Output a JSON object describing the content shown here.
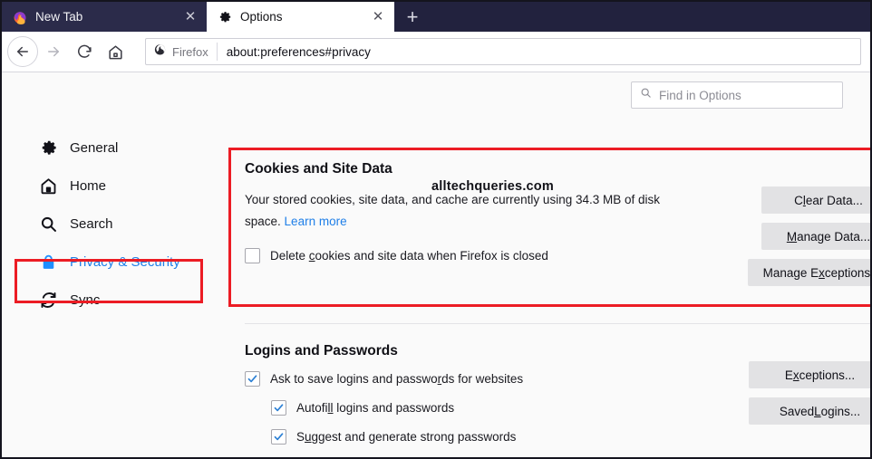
{
  "browser": {
    "tabs": [
      {
        "title": "New Tab",
        "favicon": "firefox-logo-icon",
        "active": false,
        "close_glyph": "✕"
      },
      {
        "title": "Options",
        "favicon": "gear-icon",
        "active": true,
        "close_glyph": "✕"
      }
    ],
    "new_tab_glyph": "+",
    "nav": {
      "back_label": "←",
      "forward_label": "→",
      "reload_label": "⟳",
      "home_label": "⌂"
    },
    "urlbar": {
      "identity_label": "Firefox",
      "identity_icon": "firefox-logo-icon",
      "url": "about:preferences#privacy"
    }
  },
  "sidebar": {
    "items": [
      {
        "label": "General",
        "icon": "gear-icon"
      },
      {
        "label": "Home",
        "icon": "home-icon"
      },
      {
        "label": "Search",
        "icon": "search-icon"
      },
      {
        "label": "Privacy & Security",
        "icon": "lock-icon"
      },
      {
        "label": "Sync",
        "icon": "sync-icon"
      }
    ]
  },
  "page": {
    "watermark": "alltechqueries.com",
    "search": {
      "placeholder": "Find in Options",
      "icon": "search-icon"
    }
  },
  "cookies_section": {
    "title": "Cookies and Site Data",
    "description_part1": "Your stored cookies, site data, and cache are currently using 34.3 MB of disk space.",
    "learn_more": "Learn more",
    "usage_value": "34.3 MB",
    "checkbox": {
      "label_pre": "Delete ",
      "label_key": "c",
      "label_post": "ookies and site data when Firefox is closed",
      "checked": false
    },
    "buttons": [
      {
        "pre": "C",
        "key": "l",
        "post": "ear Data..."
      },
      {
        "pre": "",
        "key": "M",
        "post": "anage Data..."
      },
      {
        "pre": "Manage E",
        "key": "x",
        "post": "ceptions..."
      }
    ]
  },
  "logins_section": {
    "title": "Logins and Passwords",
    "checkboxes": [
      {
        "pre": "Ask to save logins and passwo",
        "key": "r",
        "post": "ds for websites",
        "checked": true,
        "indent": false
      },
      {
        "pre": "Autofi",
        "key": "ll",
        "post": " logins and passwords",
        "checked": true,
        "indent": true
      },
      {
        "pre": "S",
        "key": "u",
        "post": "ggest and generate strong passwords",
        "checked": true,
        "indent": true
      }
    ],
    "buttons": [
      {
        "pre": "E",
        "key": "x",
        "post": "ceptions..."
      },
      {
        "pre": "Saved ",
        "key": "L",
        "post": "ogins..."
      }
    ]
  },
  "colors": {
    "accent_blue": "#1f7fe8",
    "highlight_red": "#ec1c24",
    "chrome_navy": "#22223e",
    "button_grey": "#e2e2e4"
  }
}
